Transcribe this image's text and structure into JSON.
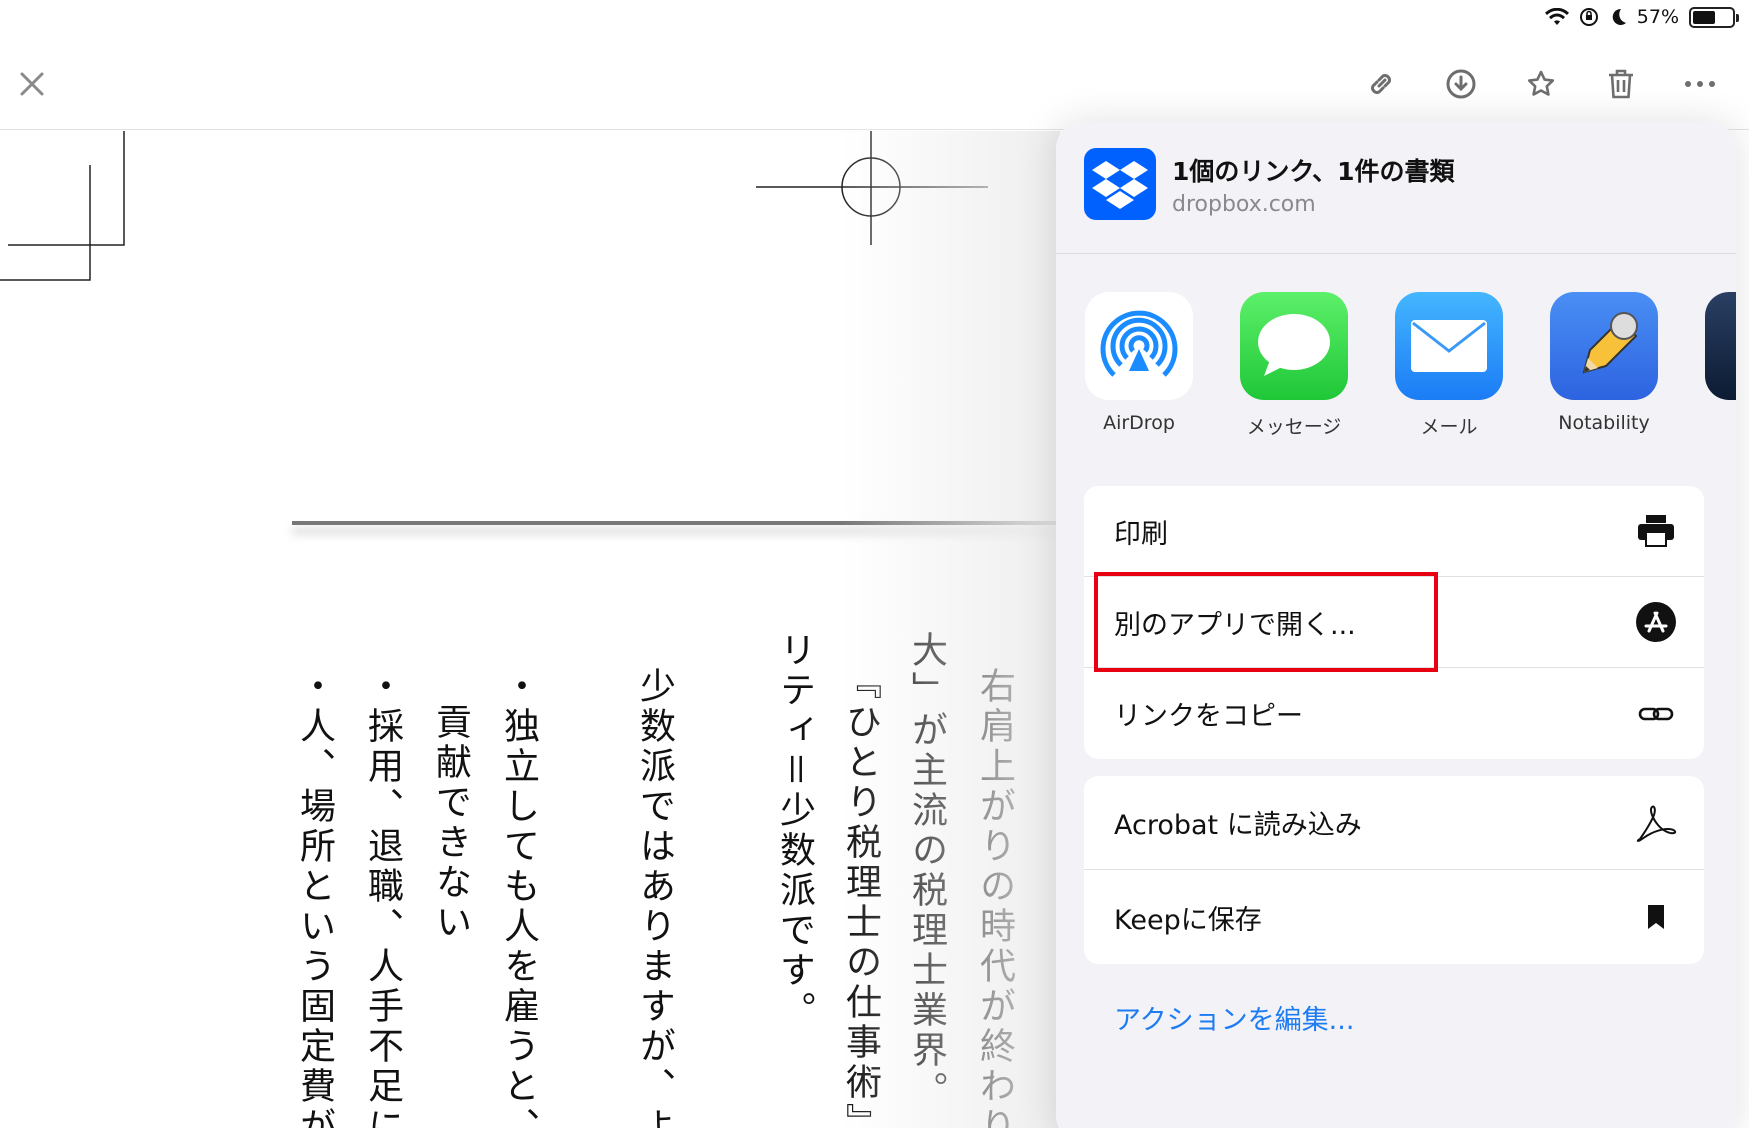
{
  "status_bar": {
    "battery_percent": "57%",
    "battery_level": 0.57
  },
  "toolbar": {
    "close_icon": "close-icon",
    "actions": [
      "link-icon",
      "download-icon",
      "star-icon",
      "trash-icon",
      "more-icon"
    ]
  },
  "document": {
    "columns": [
      "右肩上がりの時代が終わり",
      "大」が主流の税理士業界。",
      "『ひとり税理士の仕事術』を",
      "リティ＝少数派です。",
      "少数派ではありますが、よ",
      "・独立しても人を雇うと、",
      "貢献できない",
      "・採用、退職、人手不足に",
      "・人、場所という固定費が"
    ]
  },
  "share_sheet": {
    "header": {
      "title": "1個のリンク、1件の書類",
      "subtitle": "dropbox.com"
    },
    "apps": [
      {
        "label": "AirDrop"
      },
      {
        "label": "メッセージ"
      },
      {
        "label": "メール"
      },
      {
        "label": "Notability"
      }
    ],
    "group1": {
      "print": "印刷",
      "open_in": "別のアプリで開く...",
      "copy_link": "リンクをコピー"
    },
    "group2": {
      "acrobat": "Acrobat に読み込み",
      "keep": "Keepに保存"
    },
    "edit_actions": "アクションを編集..."
  },
  "colors": {
    "accent_blue": "#1e7cf2",
    "highlight_red": "#e60012",
    "dropbox_blue": "#0061fe"
  }
}
